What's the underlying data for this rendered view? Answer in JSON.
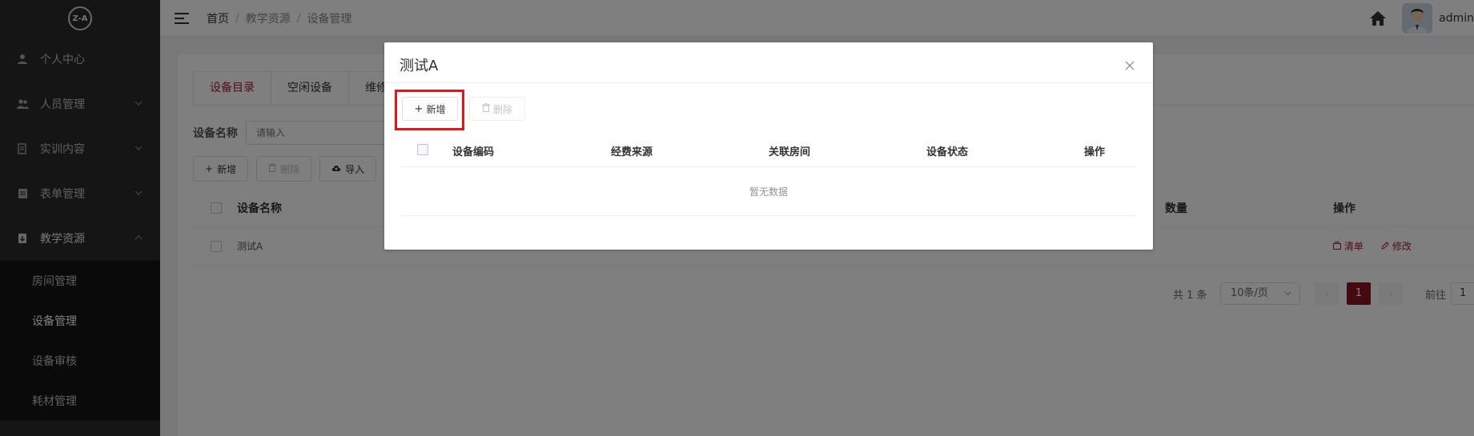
{
  "sidebar": {
    "logo_text": "Z-A",
    "items": [
      {
        "label": "个人中心",
        "icon": "user-icon"
      },
      {
        "label": "人员管理",
        "icon": "users-icon"
      },
      {
        "label": "实训内容",
        "icon": "book-icon"
      },
      {
        "label": "表单管理",
        "icon": "form-icon"
      },
      {
        "label": "教学资源",
        "icon": "resource-icon"
      }
    ],
    "sub_items": [
      {
        "label": "房间管理"
      },
      {
        "label": "设备管理"
      },
      {
        "label": "设备审核"
      },
      {
        "label": "耗材管理"
      }
    ]
  },
  "header": {
    "breadcrumb": [
      "首页",
      "教学资源",
      "设备管理"
    ],
    "username": "admin"
  },
  "main": {
    "tabs": [
      "设备目录",
      "空闲设备",
      "维修"
    ],
    "filter_label": "设备名称",
    "filter_placeholder": "请输入",
    "buttons": {
      "add": "新增",
      "delete": "删除",
      "import": "导入"
    },
    "table_headers": {
      "name": "设备名称",
      "qty": "数量",
      "ops": "操作"
    },
    "rows": [
      {
        "name": "测试A",
        "op_list": "清单",
        "op_edit": "修改"
      }
    ],
    "pagination": {
      "total": "共 1 条",
      "page_size": "10条/页",
      "current": "1",
      "goto": "前往",
      "goto_value": "1"
    }
  },
  "dialog": {
    "title": "测试A",
    "add_label": "新增",
    "delete_label": "删除",
    "headers": [
      "设备编码",
      "经费来源",
      "关联房间",
      "设备状态",
      "操作"
    ],
    "empty_text": "暂无数据"
  },
  "colors": {
    "sidebar_bg": "#2b2b2b",
    "accent": "#a61b29",
    "page_active": "#8b1421",
    "highlight": "#e0161c"
  }
}
